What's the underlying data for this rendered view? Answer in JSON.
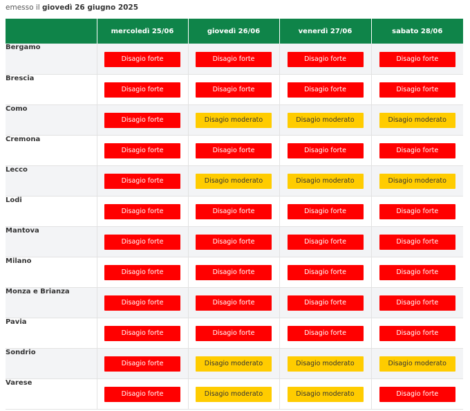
{
  "issued": {
    "prefix": "emesso il",
    "date": "giovedì 26 giugno 2025"
  },
  "columns": [
    "",
    "mercoledì 25/06",
    "giovedì 26/06",
    "venerdì 27/06",
    "sabato 28/06"
  ],
  "levels": {
    "forte": {
      "label": "Disagio forte",
      "color": "#ff0000",
      "text_color": "#ffffff"
    },
    "moderato": {
      "label": "Disagio moderato",
      "color": "#ffcc00",
      "text_color": "#333333"
    }
  },
  "header_color": "#0f8449",
  "rows": [
    {
      "province": "Bergamo",
      "days": [
        "forte",
        "forte",
        "forte",
        "forte"
      ]
    },
    {
      "province": "Brescia",
      "days": [
        "forte",
        "forte",
        "forte",
        "forte"
      ]
    },
    {
      "province": "Como",
      "days": [
        "forte",
        "moderato",
        "moderato",
        "moderato"
      ]
    },
    {
      "province": "Cremona",
      "days": [
        "forte",
        "forte",
        "forte",
        "forte"
      ]
    },
    {
      "province": "Lecco",
      "days": [
        "forte",
        "moderato",
        "moderato",
        "moderato"
      ]
    },
    {
      "province": "Lodi",
      "days": [
        "forte",
        "forte",
        "forte",
        "forte"
      ]
    },
    {
      "province": "Mantova",
      "days": [
        "forte",
        "forte",
        "forte",
        "forte"
      ]
    },
    {
      "province": "Milano",
      "days": [
        "forte",
        "forte",
        "forte",
        "forte"
      ]
    },
    {
      "province": "Monza e Brianza",
      "days": [
        "forte",
        "forte",
        "forte",
        "forte"
      ]
    },
    {
      "province": "Pavia",
      "days": [
        "forte",
        "forte",
        "forte",
        "forte"
      ]
    },
    {
      "province": "Sondrio",
      "days": [
        "forte",
        "moderato",
        "moderato",
        "moderato"
      ]
    },
    {
      "province": "Varese",
      "days": [
        "forte",
        "moderato",
        "moderato",
        "forte"
      ]
    }
  ]
}
